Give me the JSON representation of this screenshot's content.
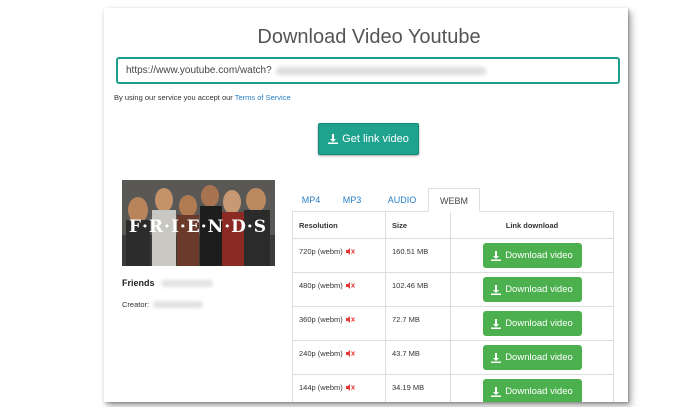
{
  "header": {
    "title": "Download Video Youtube"
  },
  "search": {
    "url_value": "https://www.youtube.com/watch?"
  },
  "terms": {
    "prefix": "By using our service you accept our ",
    "link_text": "Terms of Service"
  },
  "actions": {
    "get_link_label": "Get link video"
  },
  "video": {
    "name": "Friends",
    "creator_label": "Creator:",
    "thumbnail_text": "F·R·I·E·N·D·S"
  },
  "tabs": [
    {
      "label": "MP4"
    },
    {
      "label": "MP3"
    },
    {
      "label": "AUDIO"
    },
    {
      "label": "WEBM"
    }
  ],
  "active_tab": "WEBM",
  "table": {
    "headers": {
      "resolution": "Resolution",
      "size": "Size",
      "link": "Link download"
    },
    "rows": [
      {
        "resolution": "720p (webm)",
        "size": "160.51 MB",
        "button": "Download video"
      },
      {
        "resolution": "480p (webm)",
        "size": "102.46 MB",
        "button": "Download video"
      },
      {
        "resolution": "360p (webm)",
        "size": "72.7 MB",
        "button": "Download video"
      },
      {
        "resolution": "240p (webm)",
        "size": "43.7 MB",
        "button": "Download video"
      },
      {
        "resolution": "144p (webm)",
        "size": "34.19 MB",
        "button": "Download video"
      }
    ]
  },
  "colors": {
    "accent": "#1fa38e",
    "download": "#4cb04f",
    "link": "#2a7fc6",
    "mute": "#e53935"
  },
  "icons": {
    "download": "download-icon",
    "muted": "muted-speaker-icon"
  }
}
